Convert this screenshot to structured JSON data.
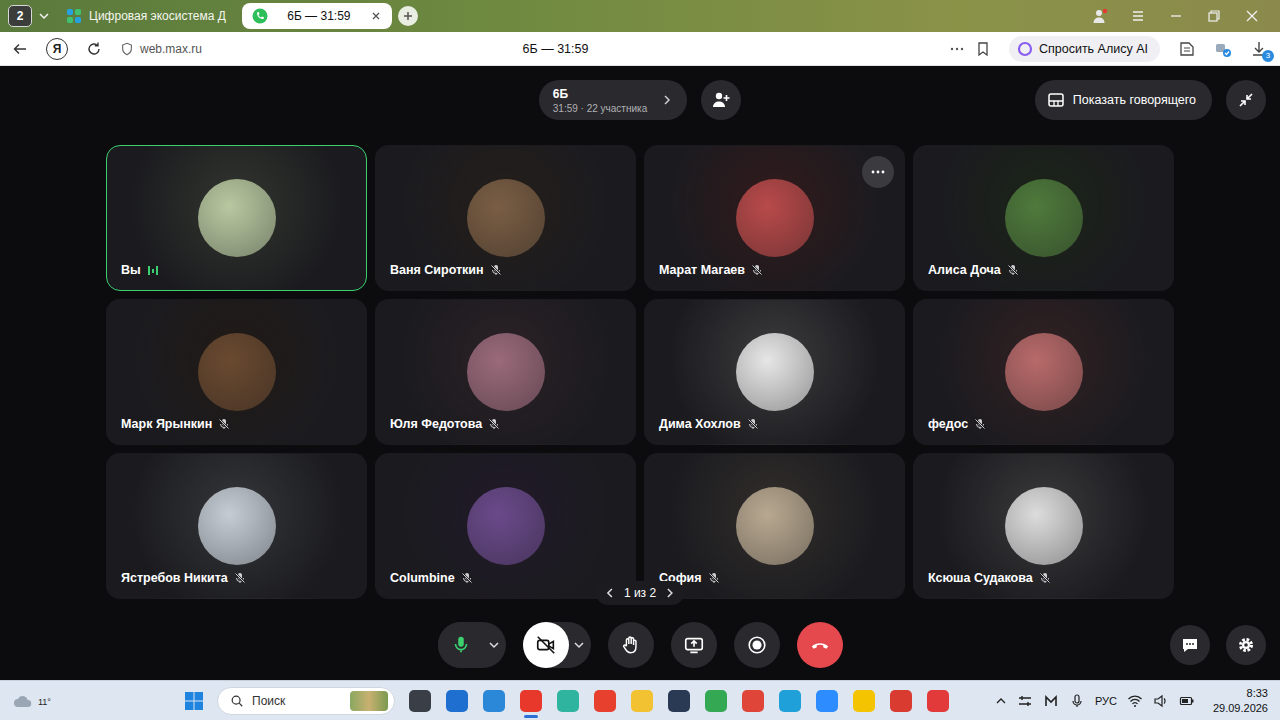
{
  "browser": {
    "tab_count": "2",
    "tabs": [
      {
        "label": "Цифровая экосистема Д",
        "selected": false
      },
      {
        "label": "6Б — 31:59",
        "selected": true
      }
    ],
    "yandex_button": "Я",
    "address": "web.max.ru",
    "page_title": "6Б — 31:59",
    "alice_button": "Спросить Алису AI",
    "downloads_badge": "3"
  },
  "call": {
    "title": "6Б",
    "subtitle": "31:59 · 22 участника",
    "show_speaker_button": "Показать говорящего",
    "participants": [
      {
        "name": "Вы",
        "muted": false,
        "speaking": true,
        "menu_shown": false,
        "color": "#b8c8a0"
      },
      {
        "name": "Ваня Сироткин",
        "muted": true,
        "speaking": false,
        "menu_shown": false,
        "color": "#7a5e44"
      },
      {
        "name": "Марат Магаев",
        "muted": true,
        "speaking": false,
        "menu_shown": true,
        "color": "#b84a4a"
      },
      {
        "name": "Алиса Доча",
        "muted": true,
        "speaking": false,
        "menu_shown": false,
        "color": "#4f7a3c"
      },
      {
        "name": "Марк Ярынкин",
        "muted": true,
        "speaking": false,
        "menu_shown": false,
        "color": "#6a4a30"
      },
      {
        "name": "Юля Федотова",
        "muted": true,
        "speaking": false,
        "menu_shown": false,
        "color": "#9a6a7a"
      },
      {
        "name": "Дима Хохлов",
        "muted": true,
        "speaking": false,
        "menu_shown": false,
        "color": "#e6e6e6"
      },
      {
        "name": "федос",
        "muted": true,
        "speaking": false,
        "menu_shown": false,
        "color": "#b86a6a"
      },
      {
        "name": "Ястребов Никита",
        "muted": true,
        "speaking": false,
        "menu_shown": false,
        "color": "#c4ccd4"
      },
      {
        "name": "Columbine",
        "muted": true,
        "speaking": false,
        "menu_shown": false,
        "color": "#6a4a8a"
      },
      {
        "name": "София",
        "muted": true,
        "speaking": false,
        "menu_shown": false,
        "color": "#b8a890"
      },
      {
        "name": "Ксюша Судакова",
        "muted": true,
        "speaking": false,
        "menu_shown": false,
        "color": "#dcdcdc"
      }
    ],
    "pager": "1 из 2",
    "controls": [
      {
        "kind": "mic",
        "on": true,
        "has_menu": true
      },
      {
        "kind": "camera",
        "on": false,
        "has_menu": true
      },
      {
        "kind": "hand",
        "on": false,
        "has_menu": false
      },
      {
        "kind": "share",
        "on": false,
        "has_menu": false
      },
      {
        "kind": "record",
        "on": false,
        "has_menu": false
      },
      {
        "kind": "hangup",
        "on": false,
        "has_menu": false
      }
    ]
  },
  "taskbar": {
    "weather": "11°",
    "search_placeholder": "Поиск",
    "apps": [
      {
        "color": "#3a3f47",
        "active": false
      },
      {
        "color": "#1f6fd1",
        "active": false
      },
      {
        "color": "#2b88d8",
        "active": false
      },
      {
        "color": "#e8382b",
        "active": true
      },
      {
        "color": "#2fb4a0",
        "active": false
      },
      {
        "color": "#e8402f",
        "active": false
      },
      {
        "color": "#f2c233",
        "active": false
      },
      {
        "color": "#2a3a55",
        "active": false
      },
      {
        "color": "#34a853",
        "active": false
      },
      {
        "color": "#e0453a",
        "active": false
      },
      {
        "color": "#1fa0d8",
        "active": false
      },
      {
        "color": "#2d8cff",
        "active": false
      },
      {
        "color": "#f5c400",
        "active": false
      },
      {
        "color": "#d93b30",
        "active": false
      },
      {
        "color": "#e23a3a",
        "active": false
      }
    ],
    "language": "РУС",
    "time": "8:33",
    "date": "29.09.2026"
  }
}
